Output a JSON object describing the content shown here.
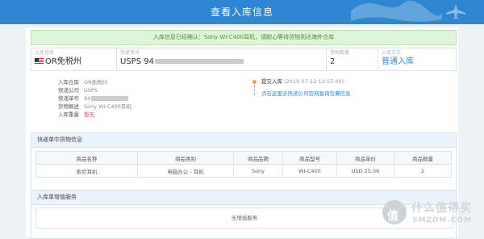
{
  "header": {
    "title": "查看入库信息"
  },
  "notice": {
    "text": "入库信息已经确认：Sony WI-C400耳机，请耐心等待货物到达海外仓库"
  },
  "summary": {
    "warehouse": {
      "label": "入库仓库",
      "value": "OR免税州",
      "flag_icon": "us-flag-icon"
    },
    "tracking": {
      "label": "快递单号",
      "value": "USPS 94"
    },
    "quantity": {
      "label": "货物数量",
      "value": "2"
    },
    "type": {
      "label": "入库方式",
      "value": "普通入库"
    }
  },
  "info": [
    {
      "label": "入库仓库",
      "value": "OR免税州"
    },
    {
      "label": "快递公司",
      "value": "USPS"
    },
    {
      "label": "快递单号",
      "value": "94"
    },
    {
      "label": "货物概述",
      "value": "Sony WI-C400耳机"
    },
    {
      "label": "入库重量",
      "value": "暂无"
    }
  ],
  "timeline": {
    "event_title": "提交入库",
    "event_date": "(2018-07-12 12:55:00)",
    "link_text": "点击这里去快递公司官网查询包裹信息"
  },
  "items_panel": {
    "title": "快递单中货物信息",
    "columns": [
      "商品名称",
      "商品类别",
      "商品品牌",
      "商品型号",
      "商品单价",
      "商品数量"
    ],
    "rows": [
      [
        "索尼耳机",
        "电脑办公 - 耳机",
        "Sony",
        "WI-C400",
        "USD 25.06",
        "2"
      ]
    ]
  },
  "services_panel": {
    "title": "入库单增值服务",
    "empty_text": "无增值服务"
  },
  "watermark": {
    "circle_glyph": "值",
    "text": "什么值得买",
    "sub": "SMZDM.COM"
  },
  "colors": {
    "header": "#2d86d1",
    "notice_bg": "#dff5d8",
    "notice_text": "#4a8c35",
    "accent": "#2d86d1",
    "timeline": "#f0a04b"
  }
}
